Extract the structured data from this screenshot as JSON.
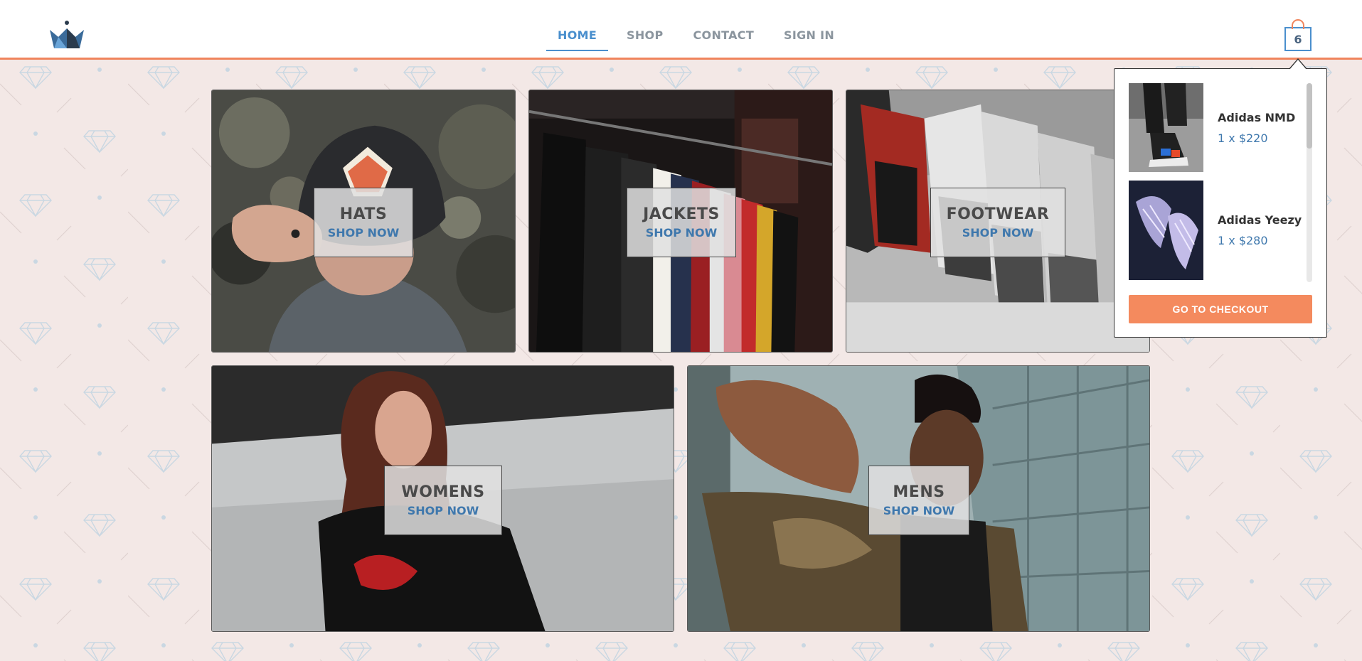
{
  "nav": {
    "items": [
      {
        "label": "HOME",
        "active": true
      },
      {
        "label": "SHOP",
        "active": false
      },
      {
        "label": "CONTACT",
        "active": false
      },
      {
        "label": "SIGN IN",
        "active": false
      }
    ]
  },
  "cart": {
    "count": "6",
    "items": [
      {
        "name": "Adidas NMD",
        "qty_price": "1 x $220"
      },
      {
        "name": "Adidas Yeezy",
        "qty_price": "1 x $280"
      }
    ],
    "checkout_label": "GO TO CHECKOUT"
  },
  "tiles": [
    {
      "title": "HATS",
      "cta": "SHOP NOW"
    },
    {
      "title": "JACKETS",
      "cta": "SHOP NOW"
    },
    {
      "title": "FOOTWEAR",
      "cta": "SHOP NOW"
    },
    {
      "title": "WOMENS",
      "cta": "SHOP NOW"
    },
    {
      "title": "MENS",
      "cta": "SHOP NOW"
    }
  ],
  "colors": {
    "accent": "#4a8fcd",
    "brand_orange": "#f0845c",
    "checkout": "#f48a5e",
    "background": "#f3e8e6"
  },
  "icons": {
    "logo": "crown-icon",
    "cart": "shopping-bag-icon"
  }
}
